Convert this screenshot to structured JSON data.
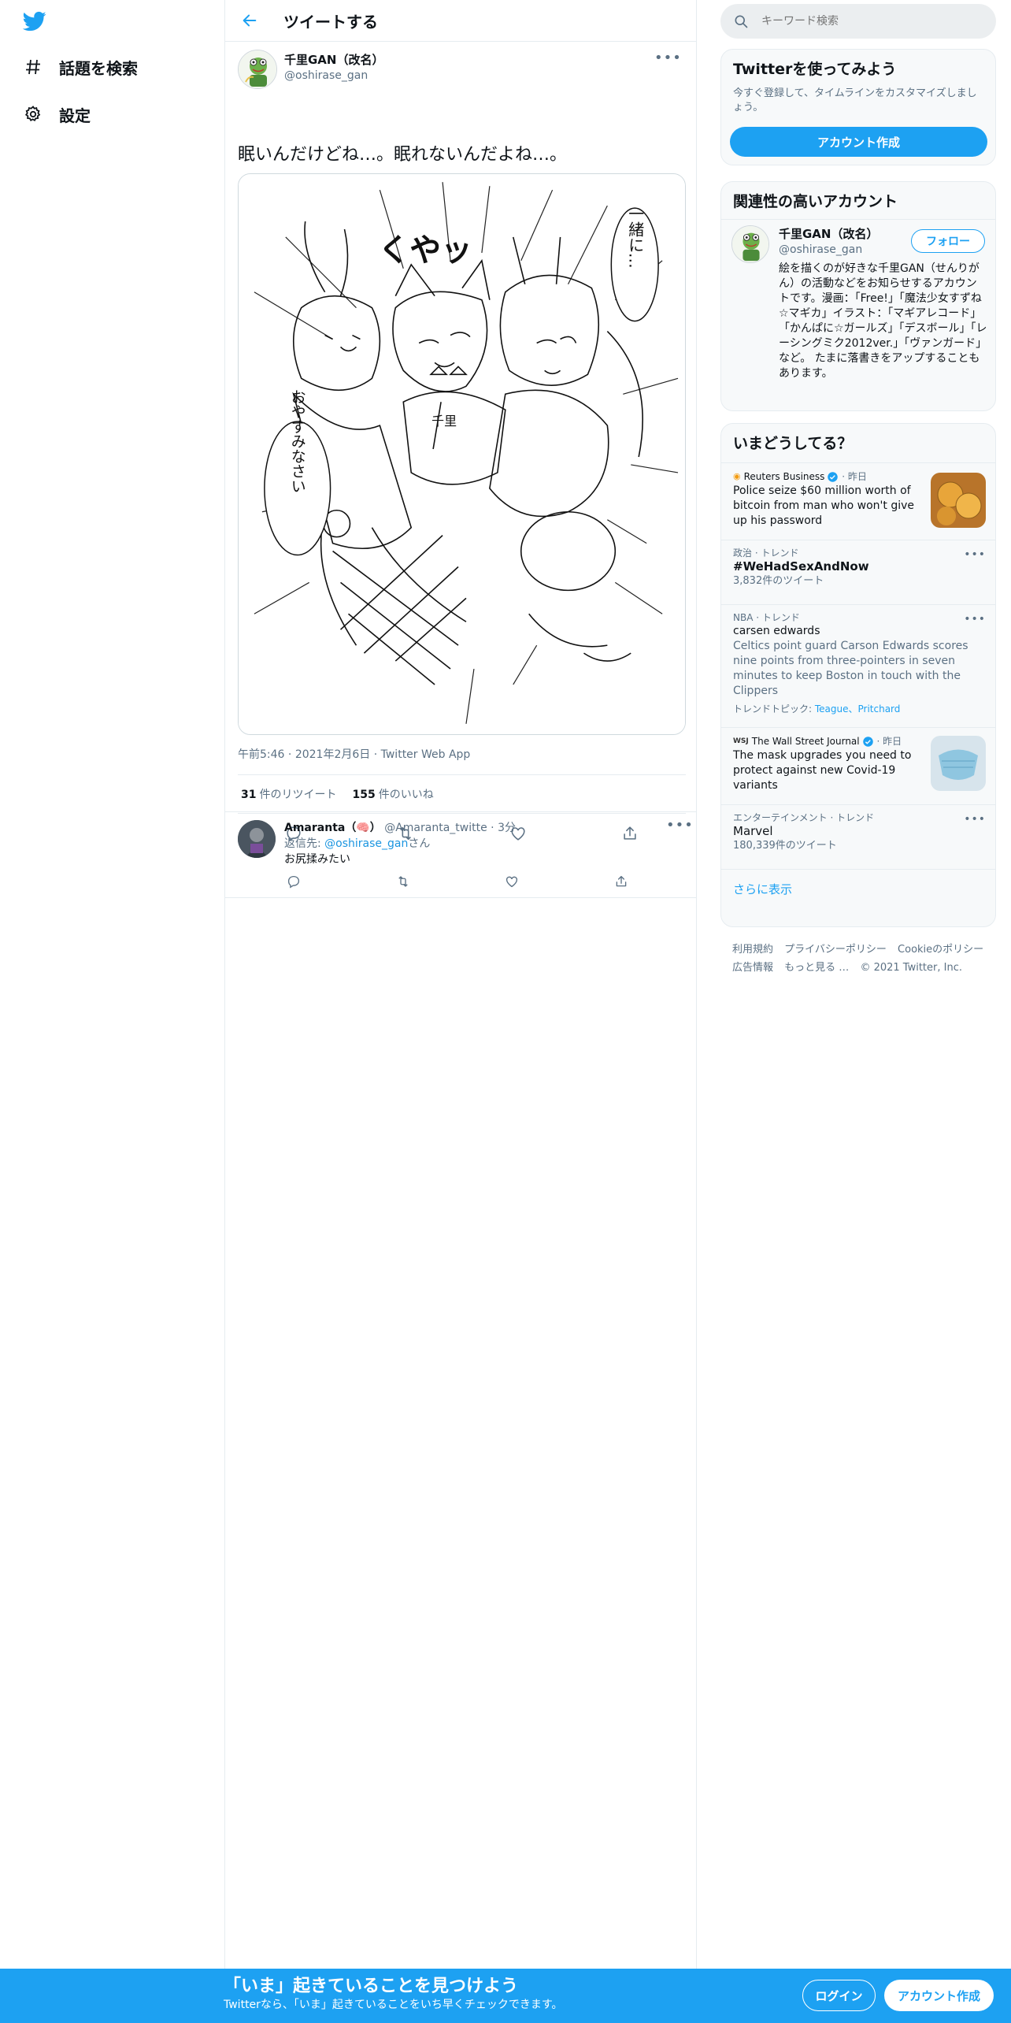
{
  "nav": {
    "items": [
      {
        "label": "話題を検索",
        "icon": "hashtag-icon"
      },
      {
        "label": "設定",
        "icon": "gear-icon"
      }
    ]
  },
  "header": {
    "title": "ツイートする"
  },
  "tweet": {
    "author_name": "千里GAN（改名）",
    "author_handle": "@oshirase_gan",
    "text": "眠いんだけどね…。眠れないんだよね…。",
    "time": "午前5:46",
    "date": "2021年2月6日",
    "source": "Twitter Web App",
    "retweets": "31",
    "retweets_label": "件のリツイート",
    "likes": "155",
    "likes_label": "件のいいね",
    "image_texts": [
      "一緒に…",
      "くやッ",
      "おやすみなさい",
      "千里"
    ]
  },
  "reply": {
    "name": "Amaranta（🧠）",
    "handle": "@Amaranta_twitte",
    "time": "3分",
    "reply_prefix": "返信先: ",
    "reply_mention": "@oshirase_gan",
    "reply_suffix": "さん",
    "text": "お尻揉みたい"
  },
  "search": {
    "placeholder": "キーワード検索"
  },
  "signup_card": {
    "title": "Twitterを使ってみよう",
    "desc": "今すぐ登録して、タイムラインをカスタマイズしましょう。",
    "button": "アカウント作成"
  },
  "related": {
    "title": "関連性の高いアカウント",
    "name": "千里GAN（改名）",
    "handle": "@oshirase_gan",
    "follow": "フォロー",
    "bio": "絵を描くのが好きな千里GAN（せんりがん）の活動などをお知らせするアカウントです。漫画：「Free!」「魔法少女すずね☆マギカ」イラスト：「マギアレコード」「かんぱに☆ガールズ」「デスボール」「レーシングミク2012ver.」「ヴァンガード」など。 たまに落書きをアップすることもあります。"
  },
  "trends": {
    "title": "いまどうしてる？",
    "news1": {
      "source": "Reuters Business",
      "time": "昨日",
      "title": "Police seize $60 million worth of bitcoin from man who won't give up his password"
    },
    "trend1": {
      "context": "政治 · トレンド",
      "title": "#WeHadSexAndNow",
      "count": "3,832件のツイート"
    },
    "trend2": {
      "context": "NBA · トレンド",
      "title": "carsen edwards",
      "desc": "Celtics point guard Carson Edwards scores nine points from three-pointers in seven minutes to keep Boston in touch with the Clippers",
      "topics_label": "トレンドトピック: ",
      "topics": "Teague、Pritchard"
    },
    "news2": {
      "source": "The Wall Street Journal",
      "time": "昨日",
      "title": "The mask upgrades you need to protect against new Covid-19 variants"
    },
    "trend3": {
      "context": "エンターテインメント · トレンド",
      "title": "Marvel",
      "count": "180,339件のツイート"
    },
    "show_more": "さらに表示"
  },
  "footer": {
    "links": [
      "利用規約",
      "プライバシーポリシー",
      "Cookieのポリシー",
      "広告情報",
      "もっと見る …",
      "© 2021 Twitter, Inc."
    ]
  },
  "bottom_bar": {
    "title": "「いま」起きていることを見つけよう",
    "subtitle": "Twitterなら、「いま」起きていることをいち早くチェックできます。",
    "login": "ログイン",
    "signup": "アカウント作成"
  },
  "colors": {
    "accent": "#1da1f2",
    "text": "#0f1419",
    "muted": "#5b7083",
    "border": "#e6ecf0"
  }
}
